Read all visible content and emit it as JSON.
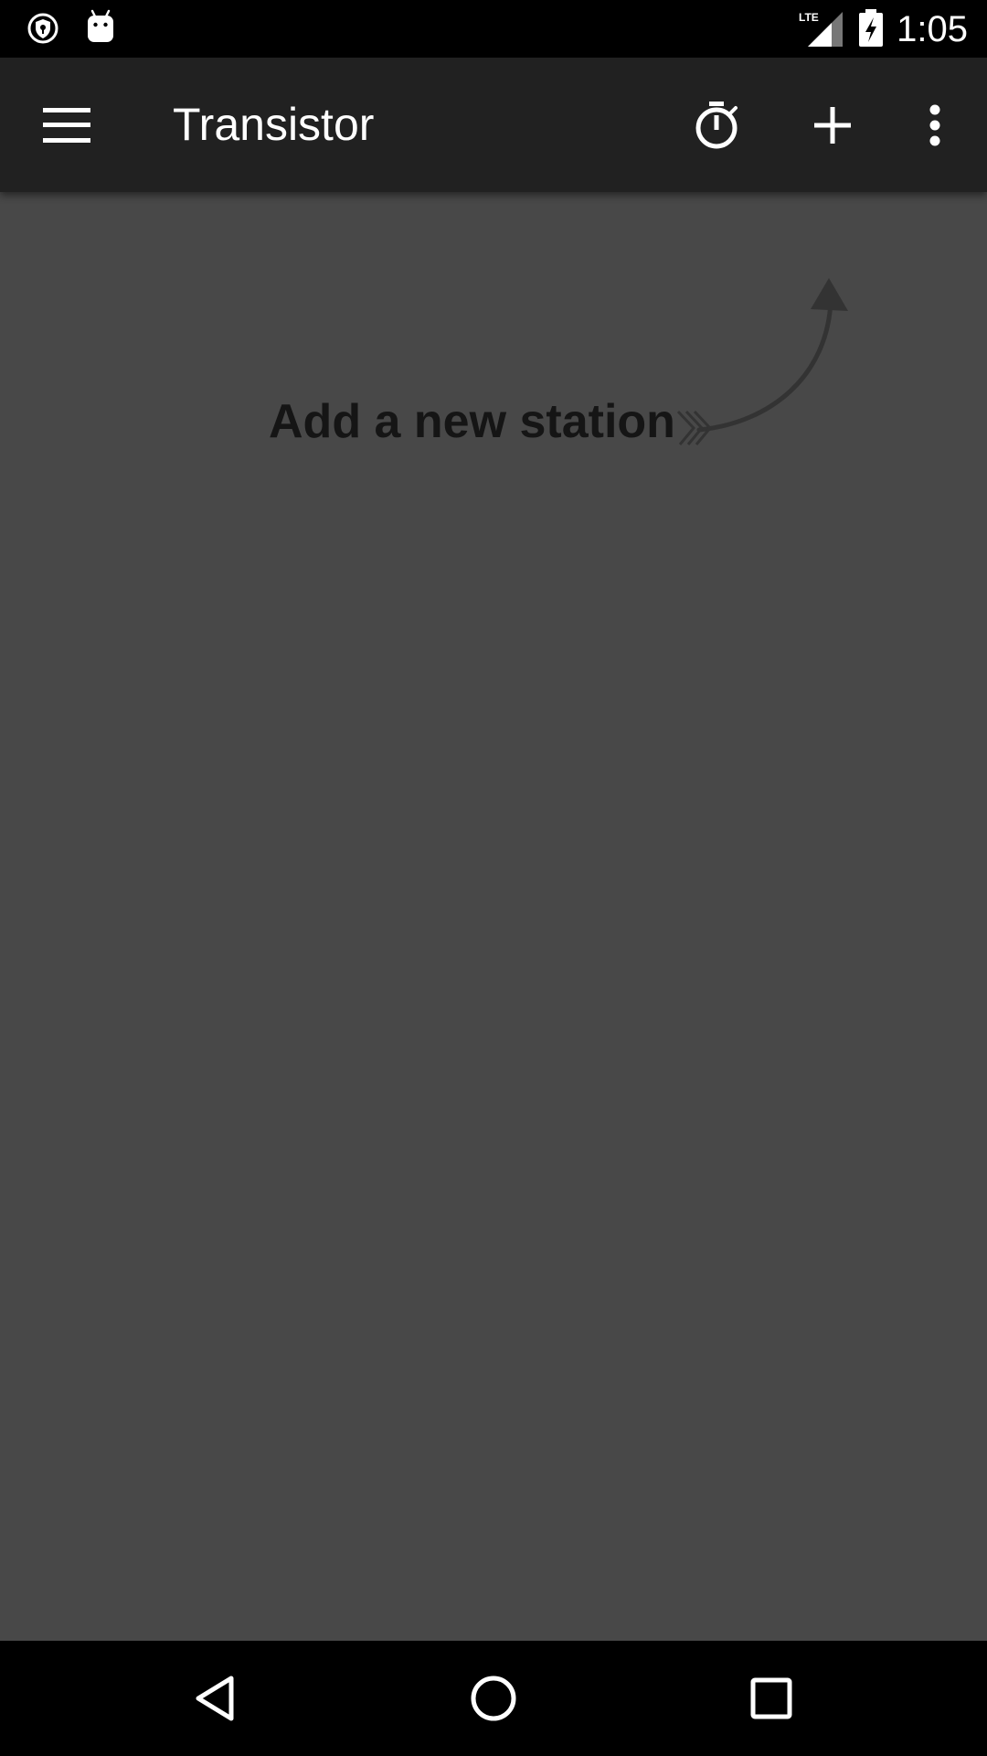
{
  "status_bar": {
    "time": "1:05",
    "network": "LTE",
    "icons": [
      "vpn-shield-icon",
      "android-debug-icon",
      "lte-signal-icon",
      "battery-charging-icon"
    ]
  },
  "app_bar": {
    "title": "Transistor",
    "actions": [
      "menu-icon",
      "timer-icon",
      "add-icon",
      "overflow-icon"
    ]
  },
  "content": {
    "hint": "Add a new station"
  },
  "nav_bar": {
    "buttons": [
      "back-icon",
      "home-icon",
      "recents-icon"
    ]
  },
  "colors": {
    "app_bar": "#212121",
    "content_bg": "#484848",
    "hint_text": "#151515",
    "arrow": "#333333"
  }
}
